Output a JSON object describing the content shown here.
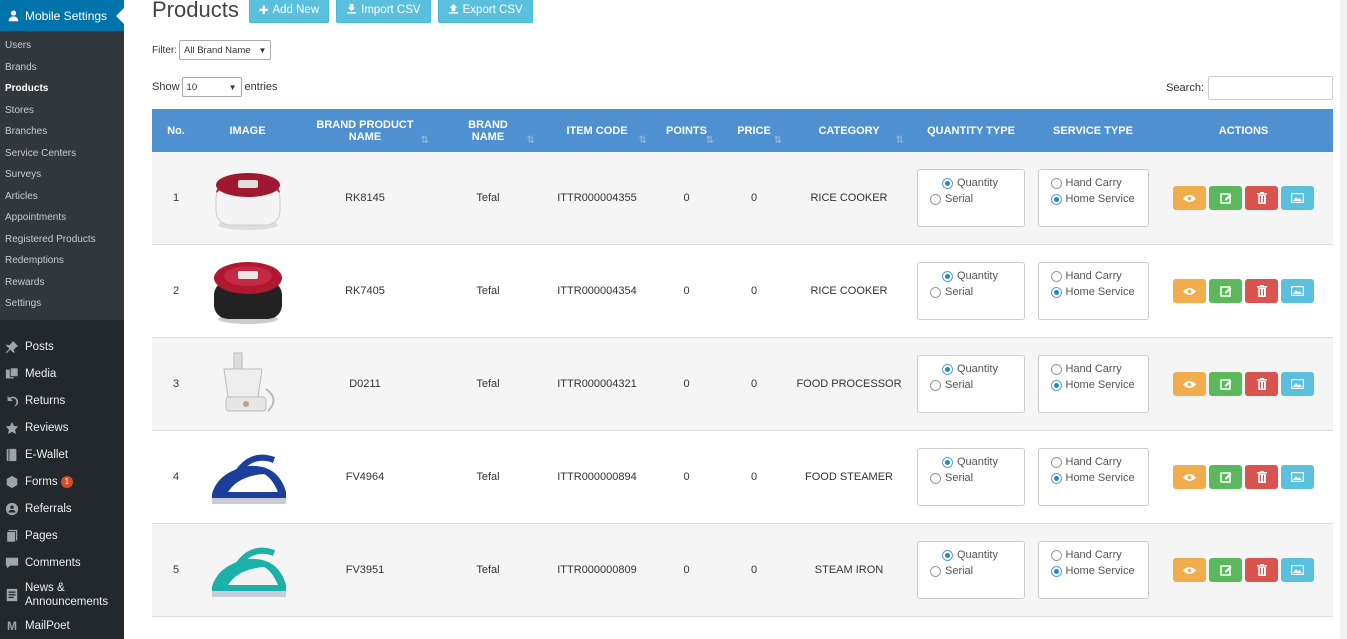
{
  "sidebar": {
    "header": "Mobile Settings",
    "submenu": [
      "Users",
      "Brands",
      "Products",
      "Stores",
      "Branches",
      "Service Centers",
      "Surveys",
      "Articles",
      "Appointments",
      "Registered Products",
      "Redemptions",
      "Rewards",
      "Settings"
    ],
    "active": "Products",
    "main": [
      {
        "label": "Posts",
        "icon": "pin-icon"
      },
      {
        "label": "Media",
        "icon": "media-icon"
      },
      {
        "label": "Returns",
        "icon": "undo-icon"
      },
      {
        "label": "Reviews",
        "icon": "star-icon"
      },
      {
        "label": "E-Wallet",
        "icon": "book-icon"
      },
      {
        "label": "Forms",
        "icon": "forms-icon",
        "badge": "1"
      },
      {
        "label": "Referrals",
        "icon": "groups-icon"
      },
      {
        "label": "Pages",
        "icon": "pages-icon"
      },
      {
        "label": "Comments",
        "icon": "comment-icon"
      },
      {
        "label": "News & Announcements",
        "icon": "news-icon"
      },
      {
        "label": "MailPoet",
        "icon": "mailpoet-icon"
      }
    ]
  },
  "header": {
    "title": "Products",
    "add_new": "Add New",
    "import_csv": "Import CSV",
    "export_csv": "Export CSV"
  },
  "filter": {
    "label": "Filter:",
    "value": "All Brand Name"
  },
  "length": {
    "show": "Show",
    "value": "10",
    "entries": "entries"
  },
  "search": {
    "label": "Search:",
    "value": ""
  },
  "table": {
    "columns": [
      "No.",
      "IMAGE",
      "BRAND PRODUCT NAME",
      "BRAND NAME",
      "ITEM CODE",
      "POINTS",
      "PRICE",
      "CATEGORY",
      "QUANTITY TYPE",
      "SERVICE TYPE",
      "ACTIONS"
    ],
    "quantity_options": [
      "Quantity",
      "Serial"
    ],
    "service_options": [
      "Hand Carry",
      "Home Service"
    ],
    "rows": [
      {
        "no": "1",
        "name": "RK8145",
        "brand": "Tefal",
        "code": "ITTR000004355",
        "points": "0",
        "price": "0",
        "category": "RICE COOKER",
        "qty": "Quantity",
        "svc": "Home Service",
        "image": "rice-cooker-white"
      },
      {
        "no": "2",
        "name": "RK7405",
        "brand": "Tefal",
        "code": "ITTR000004354",
        "points": "0",
        "price": "0",
        "category": "RICE COOKER",
        "qty": "Quantity",
        "svc": "Home Service",
        "image": "rice-cooker-red"
      },
      {
        "no": "3",
        "name": "D0211",
        "brand": "Tefal",
        "code": "ITTR000004321",
        "points": "0",
        "price": "0",
        "category": "FOOD PROCESSOR",
        "qty": "Quantity",
        "svc": "Home Service",
        "image": "food-processor"
      },
      {
        "no": "4",
        "name": "FV4964",
        "brand": "Tefal",
        "code": "ITTR000000894",
        "points": "0",
        "price": "0",
        "category": "FOOD STEAMER",
        "qty": "Quantity",
        "svc": "Home Service",
        "image": "steam-iron-blue"
      },
      {
        "no": "5",
        "name": "FV3951",
        "brand": "Tefal",
        "code": "ITTR000000809",
        "points": "0",
        "price": "0",
        "category": "STEAM IRON",
        "qty": "Quantity",
        "svc": "Home Service",
        "image": "steam-iron-teal"
      }
    ]
  },
  "colors": {
    "sidebar_bg": "#23282d",
    "sidebar_active": "#0073aa",
    "table_header": "#4f90d0",
    "btn_info": "#5bc0de",
    "btn_warning": "#f0ad4e",
    "btn_success": "#5cb85c",
    "btn_danger": "#d9534f"
  }
}
